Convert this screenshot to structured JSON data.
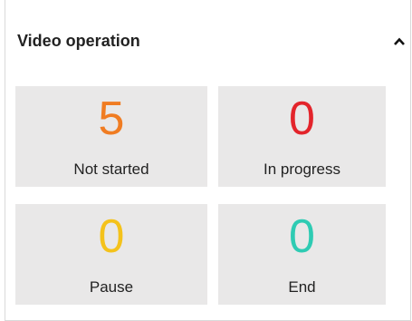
{
  "panel": {
    "title": "Video operation",
    "collapse_icon": "chevron-up-icon"
  },
  "stats": [
    {
      "value": "5",
      "label": "Not started",
      "color": "#f07c22"
    },
    {
      "value": "0",
      "label": "In progress",
      "color": "#e3242b"
    },
    {
      "value": "0",
      "label": "Pause",
      "color": "#f4c21b"
    },
    {
      "value": "0",
      "label": "End",
      "color": "#2ecbb3"
    }
  ],
  "colors": {
    "tile_background": "#e9e8e8",
    "border": "#d9d9d9",
    "text": "#222222"
  }
}
